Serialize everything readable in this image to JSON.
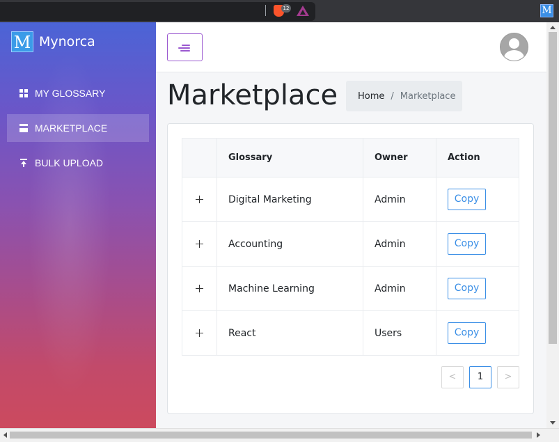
{
  "browser": {
    "shields_count": "12",
    "extension_letter": "M"
  },
  "sidebar": {
    "logo_letter": "M",
    "brand": "Mynorca",
    "items": [
      {
        "label": "MY GLOSSARY",
        "icon": "dashboard-icon",
        "active": false
      },
      {
        "label": "MARKETPLACE",
        "icon": "store-icon",
        "active": true
      },
      {
        "label": "BULK UPLOAD",
        "icon": "upload-icon",
        "active": false
      }
    ]
  },
  "header": {
    "menu_toggle_icon": "menu-toggle-icon",
    "avatar_icon": "user-avatar-icon"
  },
  "page": {
    "title": "Marketplace",
    "breadcrumb": {
      "home": "Home",
      "separator": "/",
      "current": "Marketplace"
    }
  },
  "table": {
    "columns": [
      "",
      "Glossary",
      "Owner",
      "Action"
    ],
    "rows": [
      {
        "glossary": "Digital Marketing",
        "owner": "Admin",
        "action": "Copy"
      },
      {
        "glossary": "Accounting",
        "owner": "Admin",
        "action": "Copy"
      },
      {
        "glossary": "Machine Learning",
        "owner": "Admin",
        "action": "Copy"
      },
      {
        "glossary": "React",
        "owner": "Users",
        "action": "Copy"
      }
    ]
  },
  "pagination": {
    "prev": "<",
    "current_page": "1",
    "next": ">"
  },
  "colors": {
    "accent_purple": "#9b59d0",
    "link_blue": "#3b8fe6",
    "sidebar_gradient_top": "#4b64d6",
    "sidebar_gradient_bottom": "#cc4a5e"
  }
}
